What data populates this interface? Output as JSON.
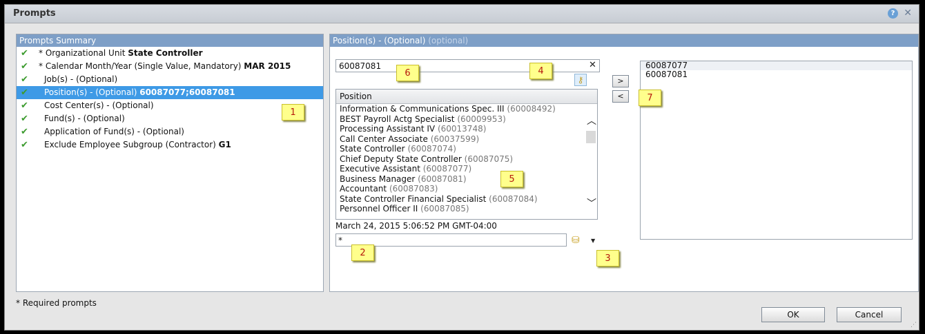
{
  "window": {
    "title": "Prompts",
    "help_icon": "question-icon",
    "close_icon": "close-icon"
  },
  "summary": {
    "header": "Prompts Summary",
    "items": [
      {
        "label": "* Organizational Unit ",
        "value": "State Controller",
        "required": true,
        "selected": false
      },
      {
        "label": "* Calendar Month/Year (Single Value, Mandatory) ",
        "value": "MAR 2015",
        "required": true,
        "selected": false
      },
      {
        "label": "Job(s) - (Optional)",
        "value": "",
        "required": false,
        "selected": false
      },
      {
        "label": "Position(s) - (Optional) ",
        "value": "60087077;60087081",
        "required": false,
        "selected": true
      },
      {
        "label": "Cost Center(s) - (Optional)",
        "value": "",
        "required": false,
        "selected": false
      },
      {
        "label": "Fund(s) - (Optional)",
        "value": "",
        "required": false,
        "selected": false
      },
      {
        "label": "Application of Fund(s) - (Optional)",
        "value": "",
        "required": false,
        "selected": false
      },
      {
        "label": "Exclude Employee Subgroup (Contractor) ",
        "value": "G1",
        "required": false,
        "selected": false
      }
    ]
  },
  "position_panel": {
    "header": "Position(s) - (Optional) ",
    "header_optional": "(optional)",
    "search_value": "60087081",
    "list_header": "Position",
    "items": [
      {
        "name": "Information & Communications Spec. III",
        "code": "(60008492)"
      },
      {
        "name": "BEST Payroll Actg Specialist",
        "code": "(60009953)"
      },
      {
        "name": "Processing Assistant IV",
        "code": "(60013748)"
      },
      {
        "name": "Call Center Associate",
        "code": "(60037599)"
      },
      {
        "name": "State Controller",
        "code": "(60087074)"
      },
      {
        "name": "Chief Deputy State Controller",
        "code": "(60087075)"
      },
      {
        "name": "Executive Assistant",
        "code": "(60087077)"
      },
      {
        "name": "Business Manager",
        "code": "(60087081)"
      },
      {
        "name": "Accountant",
        "code": "(60087083)"
      },
      {
        "name": "State Controller Financial Specialist",
        "code": "(60087084)"
      },
      {
        "name": "Personnel Officer II",
        "code": "(60087085)"
      }
    ],
    "timestamp": "March 24, 2015 5:06:52 PM GMT-04:00",
    "filter_value": "*",
    "add_label": ">",
    "remove_label": "<",
    "selected_values": [
      "60087077",
      "60087081"
    ]
  },
  "callouts": [
    "1",
    "2",
    "3",
    "4",
    "5",
    "6",
    "7"
  ],
  "footer": {
    "note": "* Required prompts",
    "ok_label": "OK",
    "cancel_label": "Cancel"
  },
  "colors": {
    "accent": "#3e9ae6",
    "panel_header": "#7e9fc7",
    "check": "#3c9b2e",
    "callout_bg": "#ffff8c",
    "callout_text": "#b5180c"
  }
}
